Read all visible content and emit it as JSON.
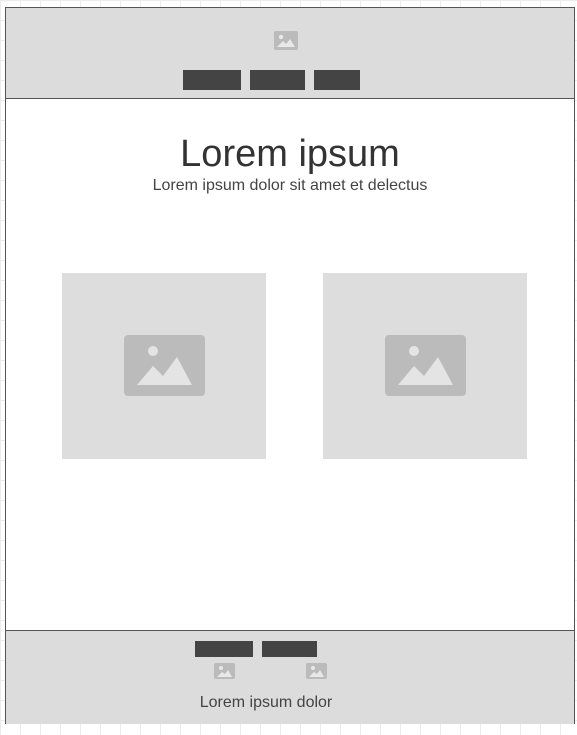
{
  "colors": {
    "header_background": "#dcdcdc",
    "button_fill": "#444444",
    "placeholder_background": "#dddddd",
    "placeholder_icon": "#bbbbbb",
    "border": "#555555",
    "text": "#333333"
  },
  "header": {
    "logo_icon": "image-placeholder-icon",
    "nav_buttons": [
      "",
      "",
      ""
    ]
  },
  "hero": {
    "title": "Lorem ipsum",
    "subtitle": "Lorem ipsum dolor sit amet et delectus"
  },
  "gallery": {
    "images": [
      {
        "icon": "image-placeholder-icon"
      },
      {
        "icon": "image-placeholder-icon"
      }
    ]
  },
  "footer": {
    "buttons": [
      "",
      ""
    ],
    "icons": [
      "image-placeholder-icon",
      "image-placeholder-icon"
    ],
    "text": "Lorem ipsum dolor"
  }
}
